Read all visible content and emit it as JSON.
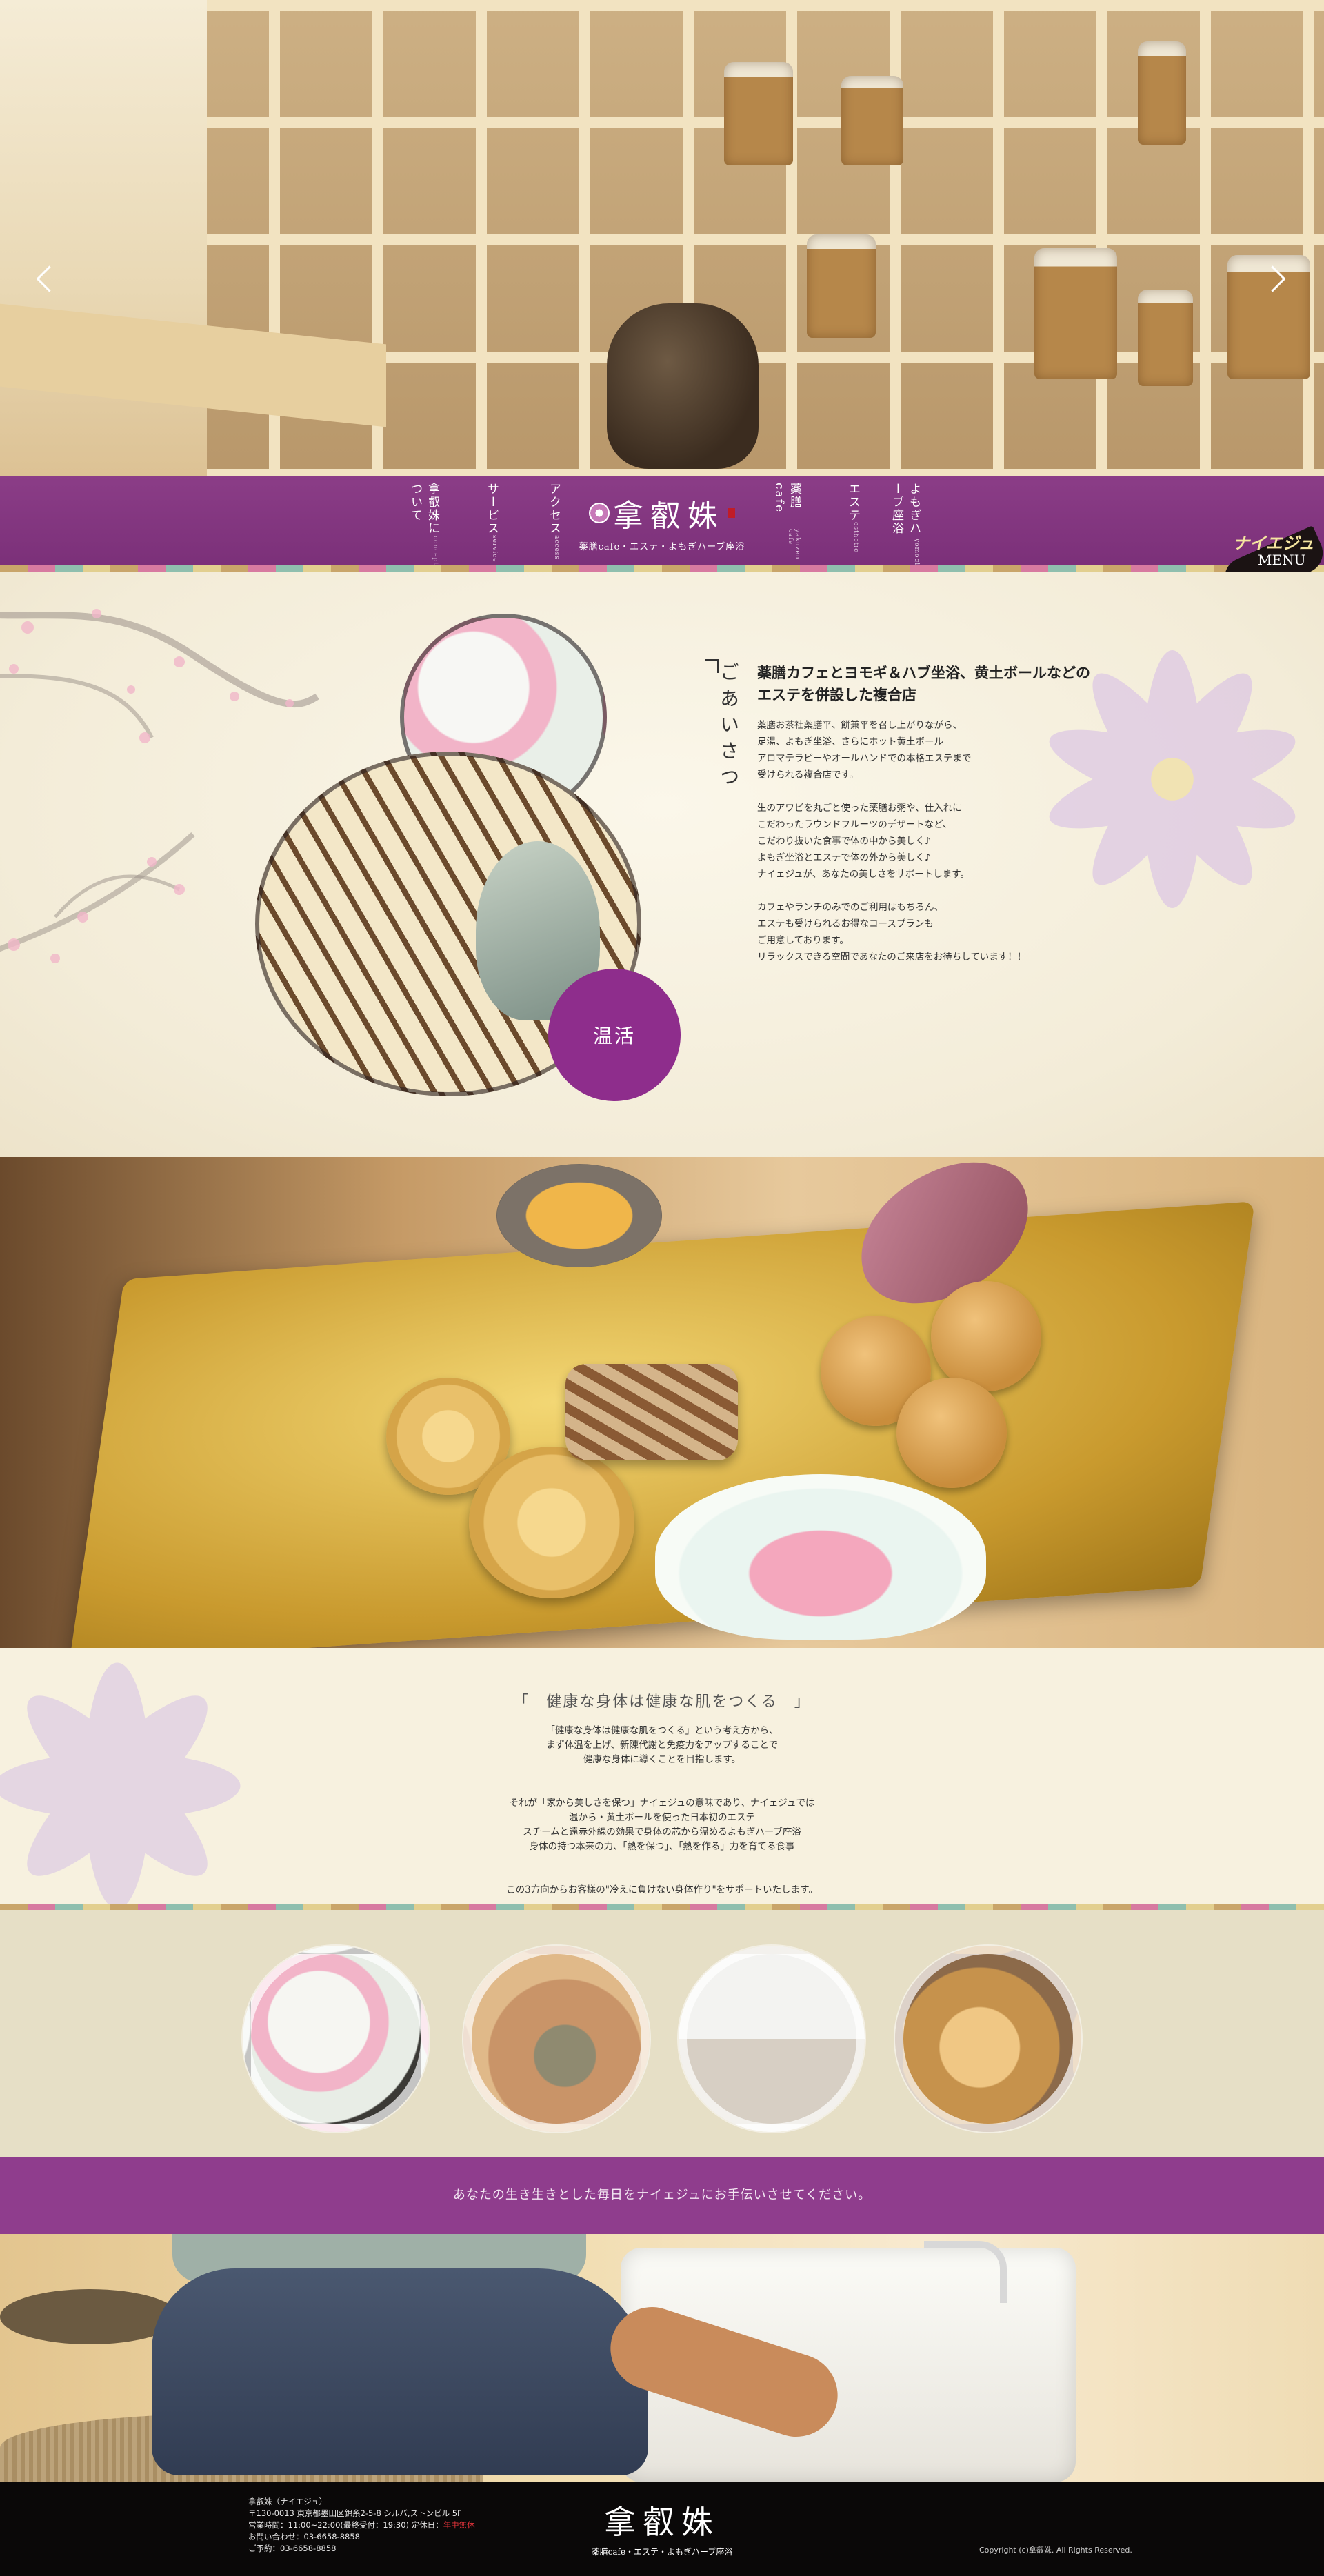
{
  "hero": {
    "prev_label": "previous",
    "next_label": "next"
  },
  "nav": {
    "items": [
      {
        "label": "拿叡姝について",
        "sub": "concept"
      },
      {
        "label": "サービス",
        "sub": "service"
      },
      {
        "label": "アクセス",
        "sub": "access"
      },
      {
        "label": "薬膳 cafe",
        "sub": "yakuzen cafe"
      },
      {
        "label": "エステ",
        "sub": "esthetic"
      },
      {
        "label": "よもぎハーブ座浴",
        "sub": "yomogi"
      }
    ],
    "logo_name": "拿叡姝",
    "logo_tagline": "薬膳cafe・エステ・よもぎハーブ座浴",
    "menu_title": "ナイエジュ",
    "menu_label": "MENU"
  },
  "greeting": {
    "vertical_title": "ごあいさつ",
    "badge": "温活",
    "heading_line1": "薬膳カフェとヨモギ＆ハブ坐浴、黄土ボールなどの",
    "heading_line2": "エステを併設した複合店",
    "paragraphs": [
      [
        "薬膳お茶社薬膳平、餅兼平を召し上がりながら、",
        "足湯、よもぎ坐浴、さらにホット黄土ボール",
        "アロマテラピーやオールハンドでの本格エステまで",
        "受けられる複合店です。"
      ],
      [
        "生のアワビを丸ごと使った薬膳お粥や、仕入れに",
        "こだわったラウンドフルーツのデザートなど、",
        "こだわり抜いた食事で体の中から美しく♪",
        "よもぎ坐浴とエステで体の外から美しく♪",
        "ナイェジュが、あなたの美しさをサポートします。"
      ],
      [
        "カフェやランチのみでのご利用はもちろん、",
        "エステも受けられるお得なコースプランも",
        "ご用意しております。",
        "リラックスできる空間であなたのご来店をお待ちしています！！"
      ]
    ]
  },
  "philosophy": {
    "title": "「　健康な身体は健康な肌をつくる　」",
    "paragraphs": [
      [
        "「健康な身体は健康な肌をつくる」という考え方から、",
        "まず体温を上げ、新陳代謝と免疫力をアップすることで",
        "健康な身体に導くことを目指します。"
      ],
      [
        "それが「家から美しさを保つ」ナイェジュの意味であり、ナイェジュでは",
        "温から・黄土ボールを使った日本初のエステ",
        "スチームと遠赤外線の効果で身体の芯から温めるよもぎハーブ座浴",
        "身体の持つ本来の力、「熱を保つ」、「熱を作る」力を育てる食事"
      ],
      [
        "この3方向からお客様の\"冷えに負けない身体作り\"をサポートいたします。"
      ]
    ]
  },
  "band": {
    "text": "あなたの生き生きとした毎日をナイェジュにお手伝いさせてください。"
  },
  "footer": {
    "lines": [
      "拿叡姝（ナイエジュ）",
      "〒130-0013 東京都墨田区錦糸2-5-8 シルバ,ストンビル 5F",
      "ご予約：03-6658-8858",
      "お問い合わせ：03-6658-8858"
    ],
    "hours_prefix": "営業時間：11:00~22:00(最終受付：19:30) 定休日：",
    "hours_holiday": "年中無休",
    "logo_name": "拿叡姝",
    "logo_tagline": "薬膳cafe・エステ・よもぎハーブ座浴",
    "copyright": "Copyright (c)拿叡姝. All Rights Reserved."
  },
  "colors": {
    "brand_purple": "#8e2d8c",
    "footer_bg": "#0a0808",
    "cream": "#f6f1e1"
  }
}
